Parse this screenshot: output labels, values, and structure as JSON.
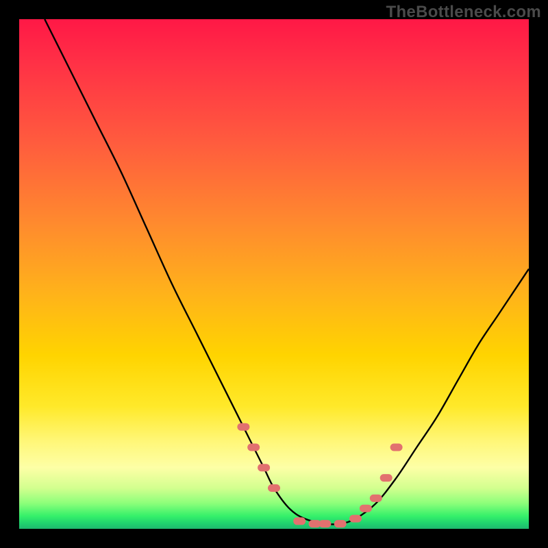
{
  "watermark": "TheBottleneck.com",
  "colors": {
    "background": "#000000",
    "gradient_top": "#ff1846",
    "gradient_mid": "#ffd400",
    "gradient_bottom": "#1fb86e",
    "curve": "#000000",
    "markers": "#e2716f"
  },
  "chart_data": {
    "type": "line",
    "title": "",
    "xlabel": "",
    "ylabel": "",
    "xlim": [
      0,
      100
    ],
    "ylim": [
      0,
      100
    ],
    "series": [
      {
        "name": "bottleneck-curve",
        "x": [
          5,
          10,
          15,
          20,
          25,
          30,
          35,
          40,
          45,
          48,
          50,
          53,
          56,
          60,
          63,
          66,
          70,
          74,
          78,
          82,
          86,
          90,
          94,
          98,
          100
        ],
        "y": [
          100,
          90,
          80,
          70,
          59,
          48,
          38,
          28,
          18,
          12,
          8,
          4,
          2,
          1,
          1,
          2,
          5,
          10,
          16,
          22,
          29,
          36,
          42,
          48,
          51
        ]
      }
    ],
    "markers": {
      "name": "highlighted-points",
      "x": [
        44,
        46,
        48,
        50,
        55,
        58,
        60,
        63,
        66,
        68,
        70,
        72,
        74
      ],
      "y": [
        20,
        16,
        12,
        8,
        1.5,
        1,
        1,
        1,
        2,
        4,
        6,
        10,
        16
      ]
    }
  }
}
